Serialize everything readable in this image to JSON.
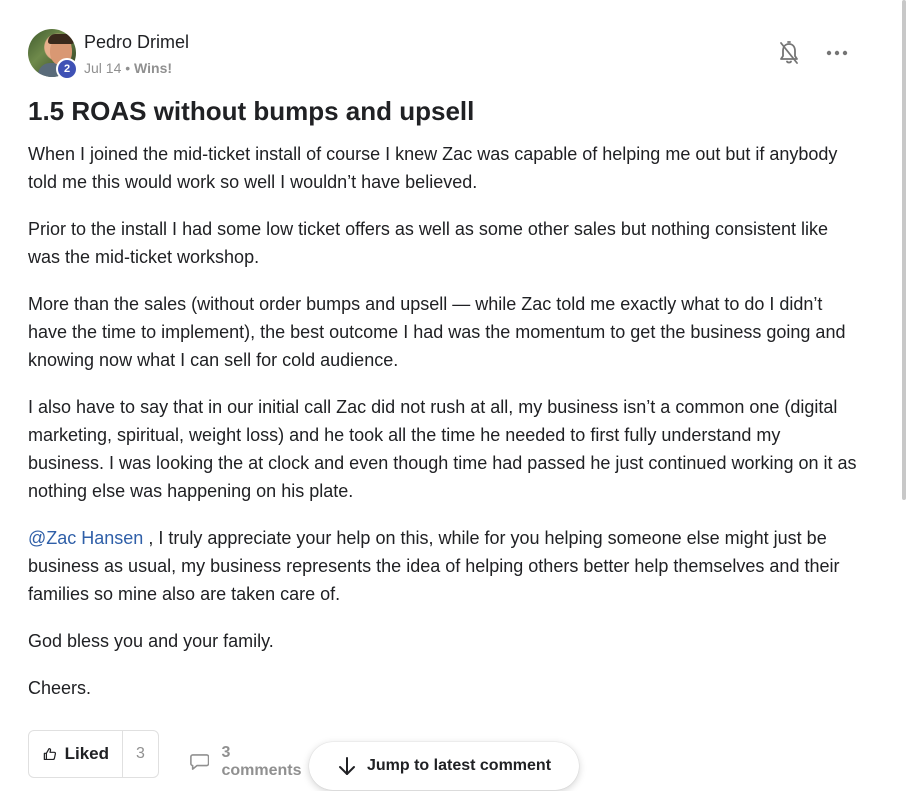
{
  "post": {
    "author": "Pedro Drimel",
    "level": "2",
    "date": "Jul 14",
    "separator": "•",
    "category": "Wins!",
    "title": "1.5 ROAS without bumps and upsell",
    "paragraphs": [
      "When I joined the mid-ticket install of course I knew Zac was capable of helping me out but if anybody told me this would work so well I wouldn’t have believed.",
      "Prior to the install I had some low ticket offers as well as some other sales but nothing consistent like was the mid-ticket workshop.",
      "More than the sales (without order bumps and upsell — while Zac told me exactly what to do I didn’t have the time to implement), the best outcome I had was the momentum to get the business going and knowing now what I can sell for cold audience.",
      "I also have to say that in our initial call Zac did not rush at all, my business isn’t a common one (digital marketing, spiritual, weight loss) and he took all the time he needed to first fully understand my business. I was looking the at clock and even though time had passed he just continued working on it as nothing else was happening on his plate."
    ],
    "mention": "@Zac Hansen",
    "mention_text": " , I truly appreciate your help on this, while for you helping someone else might just be business as usual, my business represents the idea of helping others better help themselves and their families so mine also are taken care of.",
    "closing": [
      "God bless you and your family.",
      "Cheers."
    ]
  },
  "actions": {
    "like_label": "Liked",
    "like_count": "3",
    "comments_label": "3 comments",
    "jump_label": "Jump to latest comment"
  },
  "icons": {
    "bell": "bell-off-icon",
    "more": "more-horizontal-icon",
    "like": "thumbs-up-icon",
    "comment": "comment-icon",
    "jump": "arrow-down-icon"
  },
  "colors": {
    "mention": "#2f5fa8",
    "level_badge": "#3f51b5",
    "muted": "#909090"
  }
}
